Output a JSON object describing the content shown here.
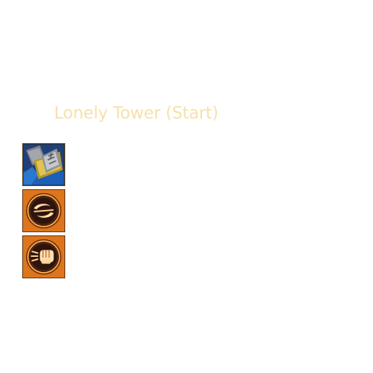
{
  "build": {
    "title": "Lonely Tower (Start)"
  },
  "items": [
    {
      "icon": "stone-tablet-item-icon",
      "interactable": true
    },
    {
      "icon": "swirl-rune-ability-icon",
      "interactable": true
    },
    {
      "icon": "fist-rune-ability-icon",
      "interactable": true
    }
  ],
  "colors": {
    "title_text": "#f6e1a9",
    "rune_orange": "#e8741c",
    "rune_dark": "#3a1a10",
    "tablet_gold": "#c9a93a",
    "tablet_blue": "#1f4fa0"
  }
}
